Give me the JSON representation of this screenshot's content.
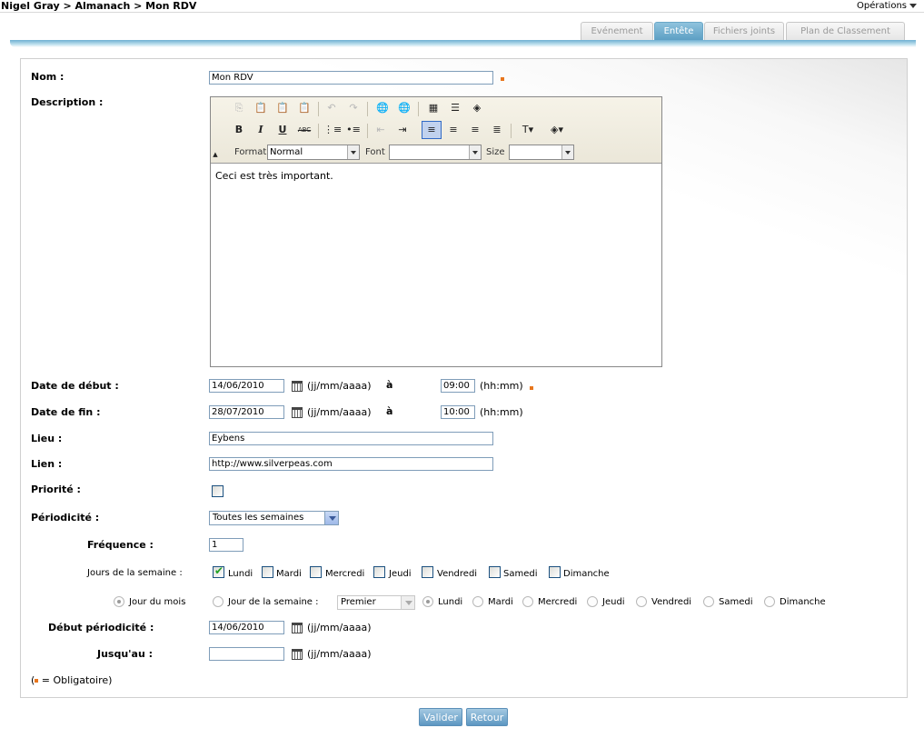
{
  "breadcrumb": "Nigel Gray > Almanach > Mon RDV",
  "operations_label": "Opérations",
  "tabs": [
    "Evénement",
    "Entête",
    "Fichiers joints",
    "Plan de Classement"
  ],
  "active_tab": "Entête",
  "colors": {
    "accent": "#5d9fc4",
    "required": "#e8761d"
  },
  "form": {
    "nom_label": "Nom :",
    "nom_value": "Mon RDV",
    "description_label": "Description :",
    "description_text": "Ceci est très important.",
    "editor": {
      "format_label": "Format",
      "format_value": "Normal",
      "font_label": "Font",
      "font_value": "",
      "size_label": "Size",
      "size_value": "",
      "bold": "B",
      "italic": "I",
      "underline": "U",
      "strike": "ABC"
    },
    "date_debut_label": "Date de début :",
    "date_debut_value": "14/06/2010",
    "date_fmt": "(jj/mm/aaaa)",
    "a_label": "à",
    "heure_debut_value": "09:00",
    "heure_fmt": "(hh:mm)",
    "date_fin_label": "Date de fin :",
    "date_fin_value": "28/07/2010",
    "heure_fin_value": "10:00",
    "lieu_label": "Lieu :",
    "lieu_value": "Eybens",
    "lien_label": "Lien :",
    "lien_value": "http://www.silverpeas.com",
    "priorite_label": "Priorité :",
    "periodicite_label": "Périodicité :",
    "periodicite_value": "Toutes les semaines",
    "frequence_label": "Fréquence :",
    "frequence_value": "1",
    "jours_label": "Jours de la semaine :",
    "days": [
      "Lundi",
      "Mardi",
      "Mercredi",
      "Jeudi",
      "Vendredi",
      "Samedi",
      "Dimanche"
    ],
    "checked_days": [
      "Lundi"
    ],
    "jour_du_mois_label": "Jour du mois",
    "jour_semaine_label": "Jour de la semaine :",
    "ordinal_value": "Premier",
    "debut_periodicite_label": "Début périodicité :",
    "debut_periodicite_value": "14/06/2010",
    "jusquau_label": "Jusqu'au :",
    "jusquau_value": ""
  },
  "legend_text": "= Obligatoire)",
  "legend_open": "(",
  "buttons": {
    "valider": "Valider",
    "retour": "Retour"
  }
}
